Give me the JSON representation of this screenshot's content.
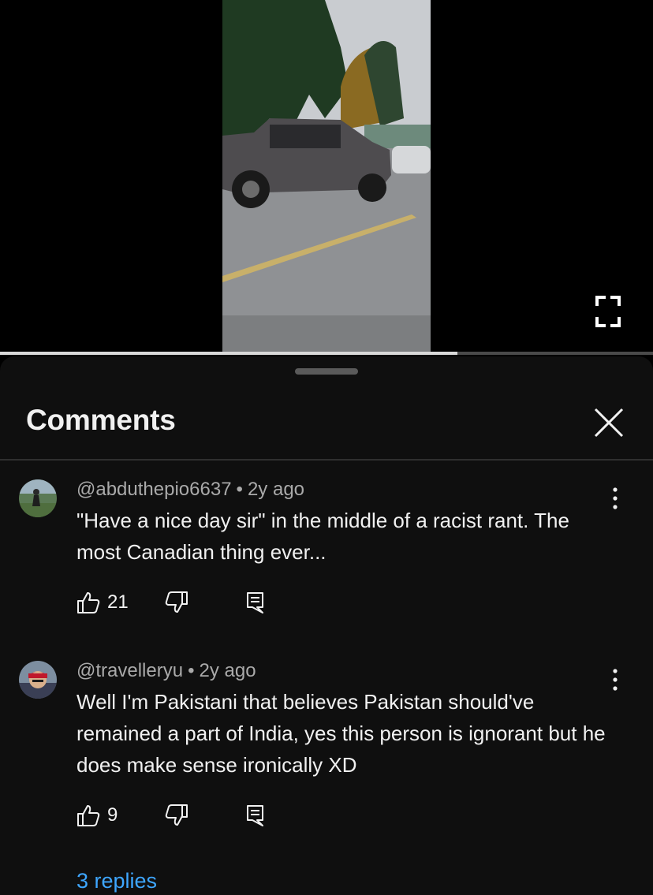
{
  "player": {
    "progress_fraction": 0.7,
    "fullscreen_icon": "fullscreen-icon"
  },
  "sheet": {
    "title": "Comments",
    "close_icon": "close-icon"
  },
  "comments": [
    {
      "author": "@abduthepio6637",
      "age": "2y ago",
      "text": "\"Have a nice day sir\" in the middle of a racist rant. The most Canadian thing ever...",
      "likes": "21"
    },
    {
      "author": "@travelleryu",
      "age": "2y ago",
      "text": "Well I'm Pakistani that believes Pakistan should've remained a part of India, yes this person is ignorant but he does make sense ironically XD",
      "likes": "9",
      "replies_label": "3 replies"
    }
  ],
  "colors": {
    "background": "#0f0f0f",
    "text": "#f1f1f1",
    "secondary_text": "#aaaaaa",
    "link": "#3ea6ff"
  }
}
